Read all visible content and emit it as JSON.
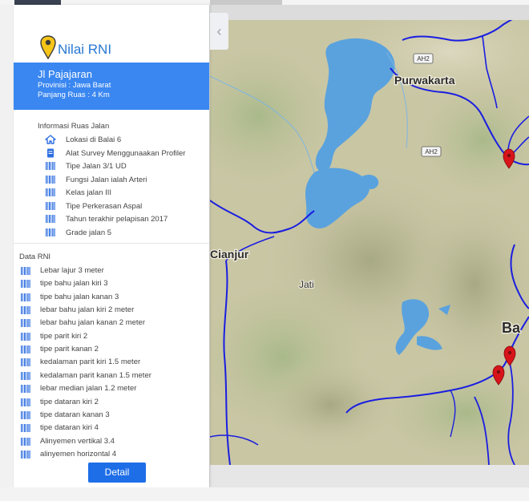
{
  "panel": {
    "title": "Nilai RNI",
    "road": {
      "name": "Jl Pajajaran",
      "province": "Provinisi : Jawa Barat",
      "length": "Panjang Ruas : 4 Km"
    },
    "info_section_label": "Informasi Ruas Jalan",
    "info_items": [
      {
        "icon": "home-icon",
        "label": "Lokasi di Balai 6"
      },
      {
        "icon": "document-icon",
        "label": "Alat Survey Menggunaakan Profiler"
      },
      {
        "icon": "barcode-icon",
        "label": "Tipe Jalan 3/1 UD"
      },
      {
        "icon": "barcode-icon",
        "label": "Fungsi Jalan ialah Arteri"
      },
      {
        "icon": "barcode-icon",
        "label": "Kelas jalan III"
      },
      {
        "icon": "barcode-icon",
        "label": "Tipe Perkerasan Aspal"
      },
      {
        "icon": "barcode-icon",
        "label": "Tahun terakhir pelapisan 2017"
      },
      {
        "icon": "barcode-icon",
        "label": "Grade jalan 5"
      }
    ],
    "rni_section_label": "Data RNI",
    "rni_items": [
      "Lebar lajur 3 meter",
      "tipe bahu jalan kiri  3",
      "tipe bahu jalan kanan 3",
      "lebar bahu jalan kiri 2 meter",
      "lebar bahu jalan kanan 2 meter",
      "tipe parit kiri 2",
      "tipe parit kanan 2",
      "kedalaman parit kiri 1.5 meter",
      "kedalaman parit kanan 1.5 meter",
      "lebar median jalan 1.2 meter",
      "tipe dataran kiri 2",
      "tipe dataran kanan 3",
      "tipe dataran kiri 4",
      "Alinyemen vertikal 3.4",
      "alinyemen horizontal 4"
    ],
    "detail_button": "Detail"
  },
  "map": {
    "labels": {
      "purwakarta": "Purwakarta",
      "cianjur": "Cianjur",
      "jati": "Jati",
      "bandung_partial": "Ba",
      "ah2_top": "AH2",
      "ah2_mid": "AH2"
    },
    "collapse_icon": "chevron-left-icon",
    "marker_icon": "map-pin-icon"
  },
  "colors": {
    "accent": "#3a87f1",
    "button": "#1e6ee8",
    "title": "#2878d2",
    "icon": "#2f6fe0",
    "road": "#1a1ee0",
    "water": "#5aa2de",
    "marker": "#d8141a"
  }
}
